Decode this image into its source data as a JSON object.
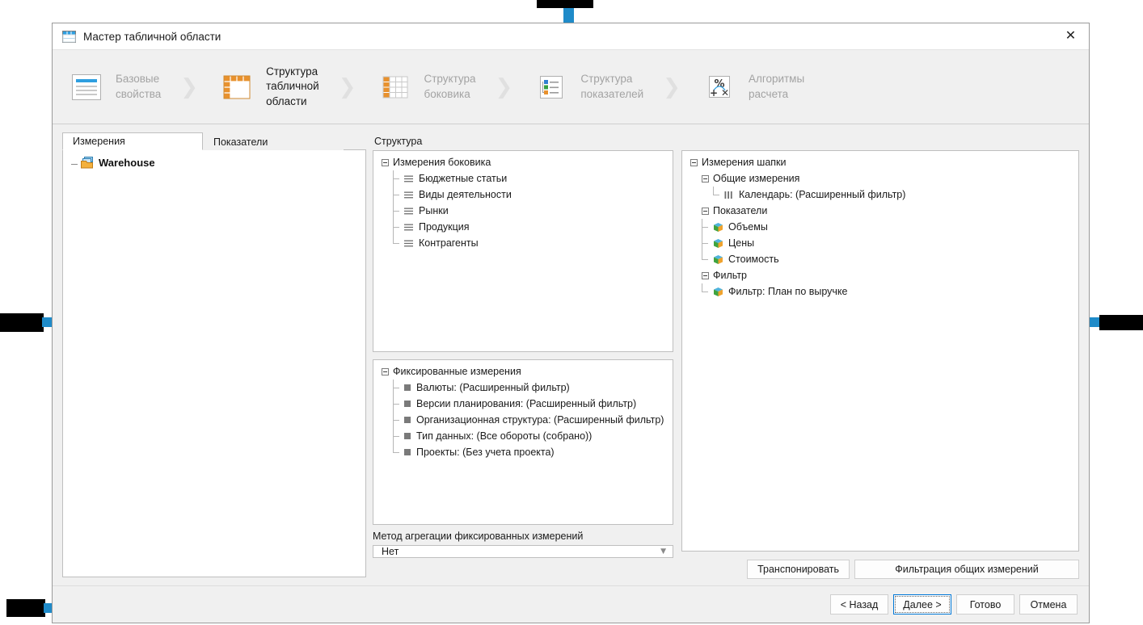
{
  "window": {
    "title": "Мастер табличной области",
    "icon": "table-grid-icon",
    "close_label": "✕"
  },
  "steps": [
    {
      "label": "Базовые\nсвойства",
      "icon": "document-properties-icon",
      "active": false
    },
    {
      "label": "Структура\nтабличной\nобласти",
      "icon": "table-structure-icon",
      "active": true
    },
    {
      "label": "Структура\nбоковика",
      "icon": "sidebar-structure-icon",
      "active": false
    },
    {
      "label": "Структура\nпоказателей",
      "icon": "measures-structure-icon",
      "active": false
    },
    {
      "label": "Алгоритмы\nрасчета",
      "icon": "calculation-algorithms-icon",
      "active": false
    }
  ],
  "step_separator": "❯",
  "tabs": [
    {
      "label": "Измерения",
      "selected": true
    },
    {
      "label": "Показатели",
      "selected": false
    }
  ],
  "dimensions_tree": {
    "root_label": "Warehouse",
    "root_icon": "warehouse-folder-icon"
  },
  "structure": {
    "label": "Структура",
    "sidebar_group": {
      "title": "Измерения боковика",
      "items": [
        "Бюджетные статьи",
        "Виды деятельности",
        "Рынки",
        "Продукция",
        "Контрагенты"
      ]
    },
    "fixed_group": {
      "title": "Фиксированные измерения",
      "items": [
        "Валюты: (Расширенный фильтр)",
        "Версии планирования: (Расширенный фильтр)",
        "Организационная структура: (Расширенный фильтр)",
        "Тип данных: (Все обороты (собрано))",
        "Проекты: (Без учета проекта)"
      ]
    },
    "header_group": {
      "title": "Измерения шапки",
      "common": {
        "title": "Общие измерения",
        "items": [
          "Календарь: (Расширенный фильтр)"
        ]
      },
      "measures": {
        "title": "Показатели",
        "items": [
          "Объемы",
          "Цены",
          "Стоимость"
        ]
      },
      "filter": {
        "title": "Фильтр",
        "items": [
          "Фильтр: План по выручке"
        ]
      }
    }
  },
  "aggregation": {
    "label": "Метод агрегации фиксированных измерений",
    "value": "Нет",
    "caret": "▼"
  },
  "actions": {
    "transpose": "Транспонировать",
    "filter_common": "Фильтрация общих измерений"
  },
  "footer": {
    "back": "< Назад",
    "next": "Далее >",
    "finish": "Готово",
    "cancel": "Отмена"
  },
  "colors": {
    "accent_blue": "#1f8bc9",
    "orange": "#e8912d",
    "focus_blue": "#0078d7",
    "muted_text": "#a3a3a3"
  }
}
